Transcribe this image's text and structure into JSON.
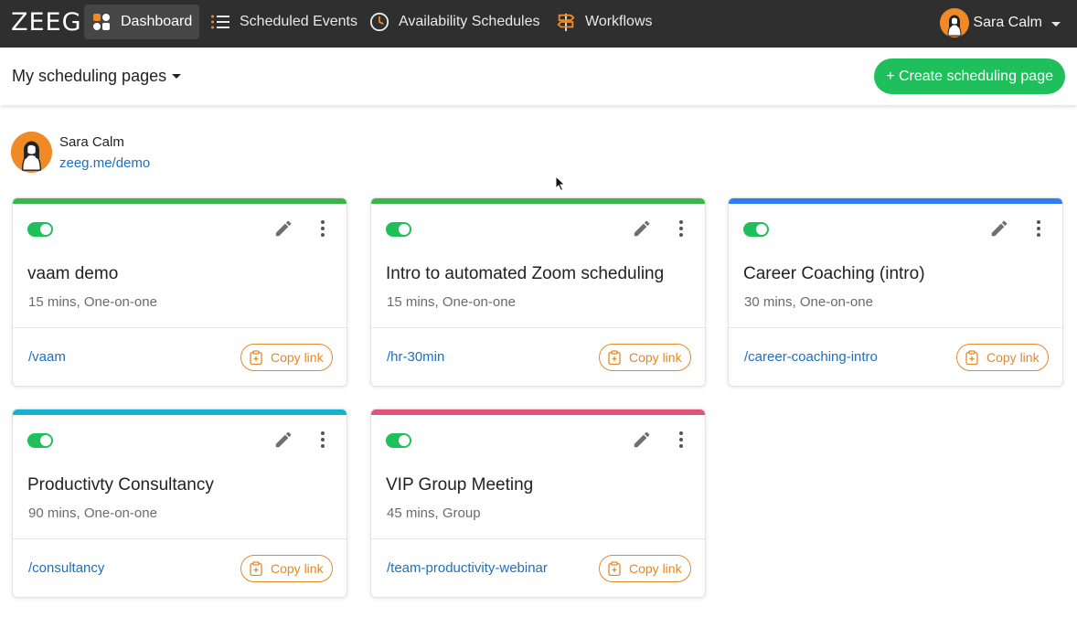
{
  "nav": {
    "logo": "ZEEG",
    "items": [
      {
        "label": "Dashboard",
        "icon": "grid-icon",
        "active": true
      },
      {
        "label": "Scheduled Events",
        "icon": "list-icon"
      },
      {
        "label": "Availability Schedules",
        "icon": "clock-icon"
      },
      {
        "label": "Workflows",
        "icon": "signpost-icon"
      }
    ],
    "user": {
      "name": "Sara Calm"
    }
  },
  "subheader": {
    "pages_select": "My scheduling pages",
    "create_button": "+ Create scheduling page"
  },
  "profile": {
    "name": "Sara Calm",
    "link": "zeeg.me/demo"
  },
  "cards": [
    {
      "title": "vaam demo",
      "meta": "15 mins, One-on-one",
      "slug": "/vaam",
      "accent": "#3cb54a",
      "enabled": true,
      "copy_label": "Copy link"
    },
    {
      "title": "Intro to automated Zoom scheduling",
      "meta": "15 mins, One-on-one",
      "slug": "/hr-30min",
      "accent": "#3cb54a",
      "enabled": true,
      "copy_label": "Copy link"
    },
    {
      "title": "Career Coaching (intro)",
      "meta": "30 mins, One-on-one",
      "slug": "/career-coaching-intro",
      "accent": "#2f7df6",
      "enabled": true,
      "copy_label": "Copy link"
    },
    {
      "title": "Productivty Consultancy",
      "meta": "90 mins, One-on-one",
      "slug": "/consultancy",
      "accent": "#13b3d0",
      "enabled": true,
      "copy_label": "Copy link"
    },
    {
      "title": "VIP Group Meeting",
      "meta": "45 mins, Group",
      "slug": "/team-productivity-webinar",
      "accent": "#e0547a",
      "enabled": true,
      "copy_label": "Copy link"
    }
  ],
  "colors": {
    "nav_bg": "#2f2f2f",
    "primary_green": "#1fbf5c",
    "link_blue": "#1f6fbf",
    "copy_orange": "#e08a2a"
  }
}
